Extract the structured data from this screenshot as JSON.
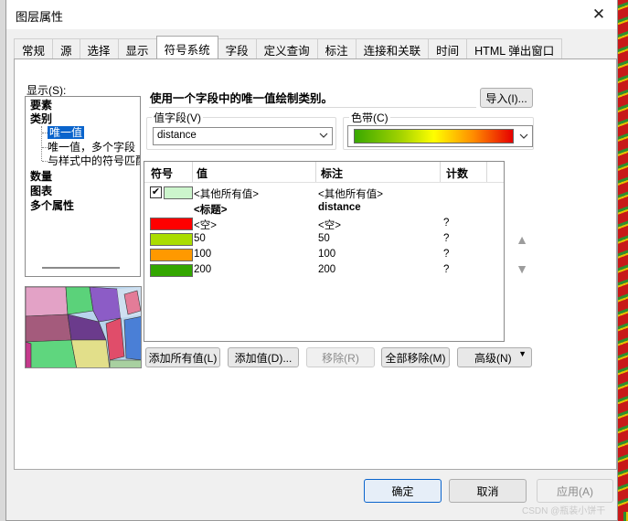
{
  "window": {
    "title": "图层属性"
  },
  "tabs": [
    {
      "label": "常规"
    },
    {
      "label": "源"
    },
    {
      "label": "选择"
    },
    {
      "label": "显示"
    },
    {
      "label": "符号系统"
    },
    {
      "label": "字段"
    },
    {
      "label": "定义查询"
    },
    {
      "label": "标注"
    },
    {
      "label": "连接和关联"
    },
    {
      "label": "时间"
    },
    {
      "label": "HTML 弹出窗口"
    }
  ],
  "show": {
    "label": "显示(S):",
    "tree": {
      "features": "要素",
      "categories": "类别",
      "unique_values": "唯一值",
      "unique_values_many": "唯一值，多个字段",
      "match_style": "与样式中的符号匹配",
      "quantities": "数量",
      "charts": "图表",
      "multiple_attributes": "多个属性"
    }
  },
  "description": "使用一个字段中的唯一值绘制类别。",
  "import_button": "导入(I)...",
  "value_field": {
    "label": "值字段(V)",
    "value": "distance"
  },
  "color_ramp": {
    "label": "色带(C)"
  },
  "table": {
    "headers": {
      "symbol": "符号",
      "value": "值",
      "label": "标注",
      "count": "计数"
    },
    "all_other": {
      "value": "<其他所有值>",
      "label": "<其他所有值>",
      "checked": true,
      "color": "#ccf5cc"
    },
    "heading": {
      "value": "<标题>",
      "label": "distance"
    },
    "rows": [
      {
        "color": "#ff0000",
        "value": "<空>",
        "label": "<空>",
        "count": "?"
      },
      {
        "color": "#aadd00",
        "value": "50",
        "label": "50",
        "count": "?"
      },
      {
        "color": "#ff9900",
        "value": "100",
        "label": "100",
        "count": "?"
      },
      {
        "color": "#33a600",
        "value": "200",
        "label": "200",
        "count": "?"
      }
    ]
  },
  "buttons": {
    "add_all": "添加所有值(L)",
    "add_values": "添加值(D)...",
    "remove": "移除(R)",
    "remove_all": "全部移除(M)",
    "advanced": "高级(N)"
  },
  "footer": {
    "ok": "确定",
    "cancel": "取消",
    "apply": "应用(A)"
  },
  "watermark": "CSDN @瓶装小饼干"
}
